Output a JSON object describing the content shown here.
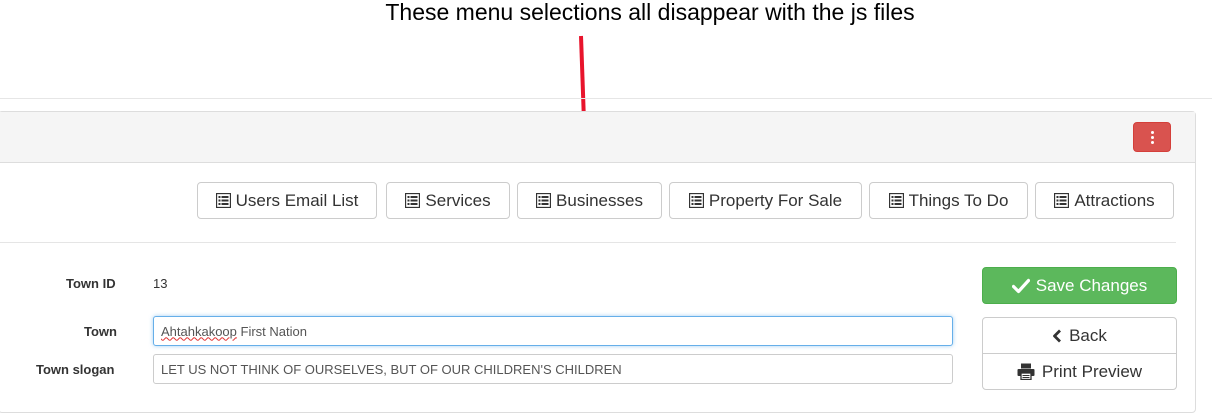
{
  "annotation": {
    "text": "These menu selections all disappear with the js files",
    "arrow_color": "#e8142c"
  },
  "header": {
    "menu_button_color": "#d9534f"
  },
  "menu": {
    "items": [
      {
        "label": "Users Email List",
        "icon": "list-alt-icon"
      },
      {
        "label": "Services",
        "icon": "list-alt-icon"
      },
      {
        "label": "Businesses",
        "icon": "list-alt-icon"
      },
      {
        "label": "Property For Sale",
        "icon": "list-alt-icon"
      },
      {
        "label": "Things To Do",
        "icon": "list-alt-icon"
      },
      {
        "label": "Attractions",
        "icon": "list-alt-icon"
      }
    ]
  },
  "form": {
    "town_id": {
      "label": "Town ID",
      "value": "13"
    },
    "town": {
      "label": "Town",
      "value_word1": "Ahtahkakoop",
      "value_rest": " First Nation"
    },
    "slogan": {
      "label": "Town slogan",
      "value": "LET US NOT THINK OF OURSELVES, BUT OF OUR CHILDREN'S CHILDREN"
    }
  },
  "actions": {
    "save_label": "Save Changes",
    "back_label": "Back",
    "print_label": "Print Preview",
    "save_color": "#5cb85c"
  }
}
